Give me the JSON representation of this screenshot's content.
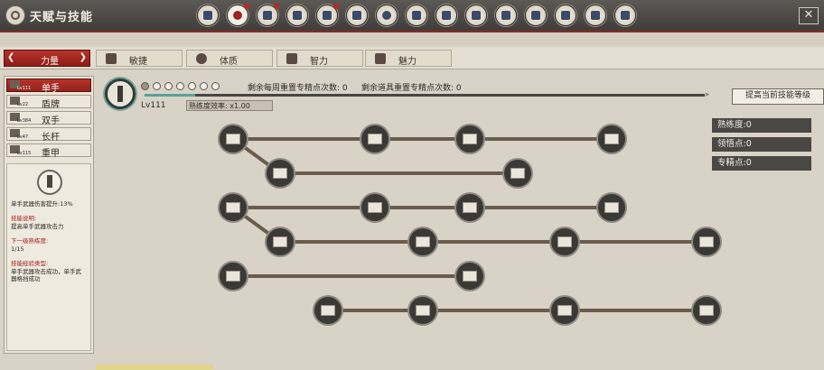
{
  "window": {
    "title": "天赋与技能",
    "close_icon": "close-icon"
  },
  "top_icons": [
    {
      "name": "character-icon"
    },
    {
      "name": "talent-skill-icon",
      "active": true,
      "alert": true
    },
    {
      "name": "mount-icon",
      "alert": true
    },
    {
      "name": "armor-icon"
    },
    {
      "name": "inventory-icon",
      "alert": true
    },
    {
      "name": "party-icon"
    },
    {
      "name": "settings-icon"
    },
    {
      "name": "world-icon"
    },
    {
      "name": "map-icon"
    },
    {
      "name": "faction-icon"
    },
    {
      "name": "book-icon"
    },
    {
      "name": "scroll-icon"
    },
    {
      "name": "encyclopedia-icon"
    },
    {
      "name": "quest-icon"
    },
    {
      "name": "town-icon"
    }
  ],
  "attribute_tabs": [
    {
      "label": "力量",
      "active": true
    },
    {
      "label": "敏捷"
    },
    {
      "label": "体质"
    },
    {
      "label": "智力"
    },
    {
      "label": "魅力"
    }
  ],
  "weapons": [
    {
      "label": "单手",
      "level": "Lv111",
      "active": true
    },
    {
      "label": "盾牌",
      "level": "Lv22"
    },
    {
      "label": "双手",
      "level": "Lv384"
    },
    {
      "label": "长杆",
      "level": "Lv47"
    },
    {
      "label": "重甲",
      "level": "Lv115"
    }
  ],
  "detail": {
    "bonus": "单手武器伤害提升:13%",
    "desc_title": "技能说明:",
    "desc": "提高单手武器攻击力",
    "next_title": "下一级熟练度:",
    "next_value": "1/15",
    "type_title": "技能经验类型:",
    "type_value": "单手武器攻击成功，单手武器格挡成功"
  },
  "skill": {
    "level": "Lv111",
    "proficiency_efficiency": "熟练度效率: x1.00",
    "weekly_reset": "剩余每周重置专精点次数: 0",
    "item_reset": "剩余道具重置专精点次数: 0",
    "upgrade_button": "提高当前技能等级",
    "progress": 0.09
  },
  "stats": [
    {
      "label": "熟练度:0"
    },
    {
      "label": "领悟点:0"
    },
    {
      "label": "专精点:0"
    }
  ],
  "colors": {
    "accent_red": "#a0231c",
    "dark": "#3a3936",
    "teal": "#58a39a"
  }
}
